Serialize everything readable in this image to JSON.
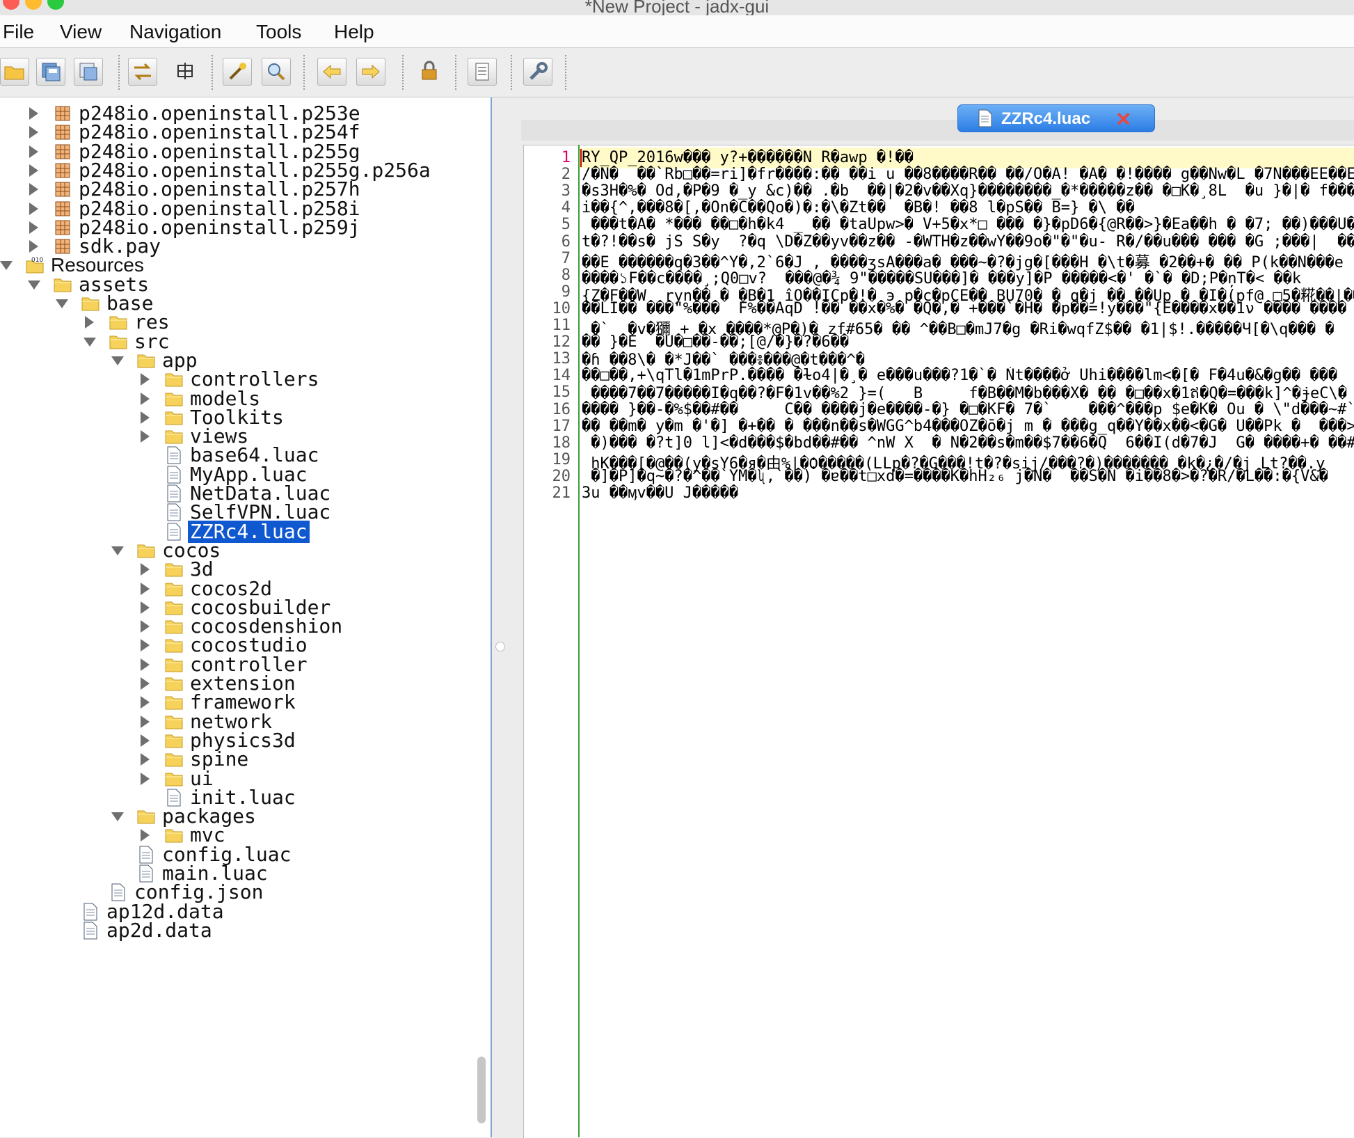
{
  "window": {
    "title": "*New Project - jadx-gui"
  },
  "menubar": [
    "File",
    "View",
    "Navigation",
    "Tools",
    "Help"
  ],
  "toolbar": [
    "open-icon",
    "save-all-icon",
    "export-icon",
    "sync-icon",
    "flatten-icon",
    "decompile-icon",
    "search-icon",
    "back-icon",
    "forward-icon",
    "deobfuscate-icon",
    "log-icon",
    "preferences-icon"
  ],
  "tree": [
    {
      "label": "p248io.openinstall.p253e",
      "type": "package",
      "depth": 1,
      "arrow": "right"
    },
    {
      "label": "p248io.openinstall.p254f",
      "type": "package",
      "depth": 1,
      "arrow": "right"
    },
    {
      "label": "p248io.openinstall.p255g",
      "type": "package",
      "depth": 1,
      "arrow": "right"
    },
    {
      "label": "p248io.openinstall.p255g.p256a",
      "type": "package",
      "depth": 1,
      "arrow": "right"
    },
    {
      "label": "p248io.openinstall.p257h",
      "type": "package",
      "depth": 1,
      "arrow": "right"
    },
    {
      "label": "p248io.openinstall.p258i",
      "type": "package",
      "depth": 1,
      "arrow": "right"
    },
    {
      "label": "p248io.openinstall.p259j",
      "type": "package",
      "depth": 1,
      "arrow": "right"
    },
    {
      "label": "sdk.pay",
      "type": "package",
      "depth": 1,
      "arrow": "right"
    },
    {
      "label": "Resources",
      "type": "resources",
      "depth": 0,
      "arrow": "down"
    },
    {
      "label": "assets",
      "type": "folder",
      "depth": 1,
      "arrow": "down"
    },
    {
      "label": "base",
      "type": "folder",
      "depth": 2,
      "arrow": "down"
    },
    {
      "label": "res",
      "type": "folder",
      "depth": 3,
      "arrow": "right"
    },
    {
      "label": "src",
      "type": "folder",
      "depth": 3,
      "arrow": "down"
    },
    {
      "label": "app",
      "type": "folder",
      "depth": 4,
      "arrow": "down"
    },
    {
      "label": "controllers",
      "type": "folder",
      "depth": 5,
      "arrow": "right"
    },
    {
      "label": "models",
      "type": "folder",
      "depth": 5,
      "arrow": "right"
    },
    {
      "label": "Toolkits",
      "type": "folder",
      "depth": 5,
      "arrow": "right"
    },
    {
      "label": "views",
      "type": "folder",
      "depth": 5,
      "arrow": "right"
    },
    {
      "label": "base64.luac",
      "type": "file",
      "depth": 5,
      "arrow": ""
    },
    {
      "label": "MyApp.luac",
      "type": "file",
      "depth": 5,
      "arrow": ""
    },
    {
      "label": "NetData.luac",
      "type": "file",
      "depth": 5,
      "arrow": ""
    },
    {
      "label": "SelfVPN.luac",
      "type": "file",
      "depth": 5,
      "arrow": ""
    },
    {
      "label": "ZZRc4.luac",
      "type": "file",
      "depth": 5,
      "arrow": "",
      "selected": true
    },
    {
      "label": "cocos",
      "type": "folder",
      "depth": 4,
      "arrow": "down"
    },
    {
      "label": "3d",
      "type": "folder",
      "depth": 5,
      "arrow": "right"
    },
    {
      "label": "cocos2d",
      "type": "folder",
      "depth": 5,
      "arrow": "right"
    },
    {
      "label": "cocosbuilder",
      "type": "folder",
      "depth": 5,
      "arrow": "right"
    },
    {
      "label": "cocosdenshion",
      "type": "folder",
      "depth": 5,
      "arrow": "right"
    },
    {
      "label": "cocostudio",
      "type": "folder",
      "depth": 5,
      "arrow": "right"
    },
    {
      "label": "controller",
      "type": "folder",
      "depth": 5,
      "arrow": "right"
    },
    {
      "label": "extension",
      "type": "folder",
      "depth": 5,
      "arrow": "right"
    },
    {
      "label": "framework",
      "type": "folder",
      "depth": 5,
      "arrow": "right"
    },
    {
      "label": "network",
      "type": "folder",
      "depth": 5,
      "arrow": "right"
    },
    {
      "label": "physics3d",
      "type": "folder",
      "depth": 5,
      "arrow": "right"
    },
    {
      "label": "spine",
      "type": "folder",
      "depth": 5,
      "arrow": "right"
    },
    {
      "label": "ui",
      "type": "folder",
      "depth": 5,
      "arrow": "right"
    },
    {
      "label": "init.luac",
      "type": "file",
      "depth": 5,
      "arrow": ""
    },
    {
      "label": "packages",
      "type": "folder",
      "depth": 4,
      "arrow": "down"
    },
    {
      "label": "mvc",
      "type": "folder",
      "depth": 5,
      "arrow": "right"
    },
    {
      "label": "config.luac",
      "type": "file",
      "depth": 4,
      "arrow": ""
    },
    {
      "label": "main.luac",
      "type": "file",
      "depth": 4,
      "arrow": ""
    },
    {
      "label": "config.json",
      "type": "file",
      "depth": 3,
      "arrow": ""
    },
    {
      "label": "ap12d.data",
      "type": "file",
      "depth": 2,
      "arrow": ""
    },
    {
      "label": "ap2d.data",
      "type": "file",
      "depth": 2,
      "arrow": ""
    }
  ],
  "editor": {
    "tab_label": "ZZRc4.luac",
    "active_line": 1,
    "lines": [
      "RY_QP_2016w��� y?+������N R�awp �!��",
      "/�N�  ��`Rb□��=ri]�fr����:�� ��i u ��8����R�� ��/O�A! �A� �!���� g��Nw�L �7N���EE��E",
      "�s3H�%� Od,�P�9 �_y &c)�� .�b  ��|�2�v��Xq}��������_�*�����z�� �□K�¸8L  �u }�|� f���",
      "i��{^,���8�[,�On�C��Qo�)�:�\\�Zt��  �B�! ��8 l�pS�� B=} �\\ ��",
      " ���t�A� *��� ��□�h�k4 _ �� �taUpw>� V+5�x*□ ��� �}�pD6�{@R��>}�Ea��h � �7; ��)���U�",
      "t�?!��s� jS S�y  ?�q \\D�Z��yv��z�� -�WTH�z��wY��9o�\"�\"�u- R�/��u��� ��� �G ;���|  ��",
      "��E ������q�3��^Y�,2`6�J , ����ʒsA���a� ���~�?�jg�[���H �\\t�募 �2��+� �� P(k��N���e",
      "����১F��c����¸;Q0□v?  ���@�¾ 9\"�����SU���]� ���y]�P �����<�' �`� �D;P�n̦T�< ��k",
      "{Z�F��W  ryn�� � �B�1 îO��ICp�!� э p�c�pCE�� BU70� � q�j �� ��Up � �I�(pf@ □5�糀��|�� ",
      "��LI�� ���\"%���  F%��AqD !�� ��x�%� �Q�,� +���`�H� ̂�p��=!y���\"{E����x��1ν ���� ����",
      " �`  �v�獼 + �x ����*@P�)� zf#65� �� ^��B□�mJ7�g �Ri�wqfZ$�� �1|$!.�����Ч[�\\q��� �",
      "�� }�E  �U�□��-��;[@/�}�?�6��",
      "�ɦ ��8\\� �*J��` ���៖���@�t���^�",
      "��□��,+\\qTl�1mPrP.���� �ɫo4|�¸� e���u���?1�`� Ǹt����ở Uhi����lm<�[� F�4u�&�g�� ���",
      " ����7��7�����I�q��?�F�1v��%2 }=(   B     f�B��M�b���X� �� �□��x�1ឥ�Q�=���k]^�ɉeC\\�",
      "���� }��-�%$��#��     C�� ����j�e����-�} �□�KF� 7�`    ���^���p $e�K� Ou � \\\"d���~#`2o",
      "�� ��m� y�m �'�] �+�� � ���n��s�WGG^b4���OZ�ō�j m � ���g_q��Y��x��<�G� U��Pk �  ���>",
      " �)��� �?t]0 l]<�d���$�bd��#�� ^nW X  � N�2��s�m��$7��6�Q  6��I(d�7�J  G� ����+� ��#a",
      " hK���[�@��(y�sY6�я�由%|�Ѻ�����(ԼLp�?�G���!t�?�sij/���?�)������� �k�¿�/�j Lt?��.y",
      " �]�P]�q~�?�^��`YM�ʯ,`��) �ɐ��t□xd�=����K�hH₂₆ j�N�  ��S�Ń �i��8�>�?�R/�L��:�{V&�",
      "3u ��ӎv��U J�����"
    ]
  }
}
